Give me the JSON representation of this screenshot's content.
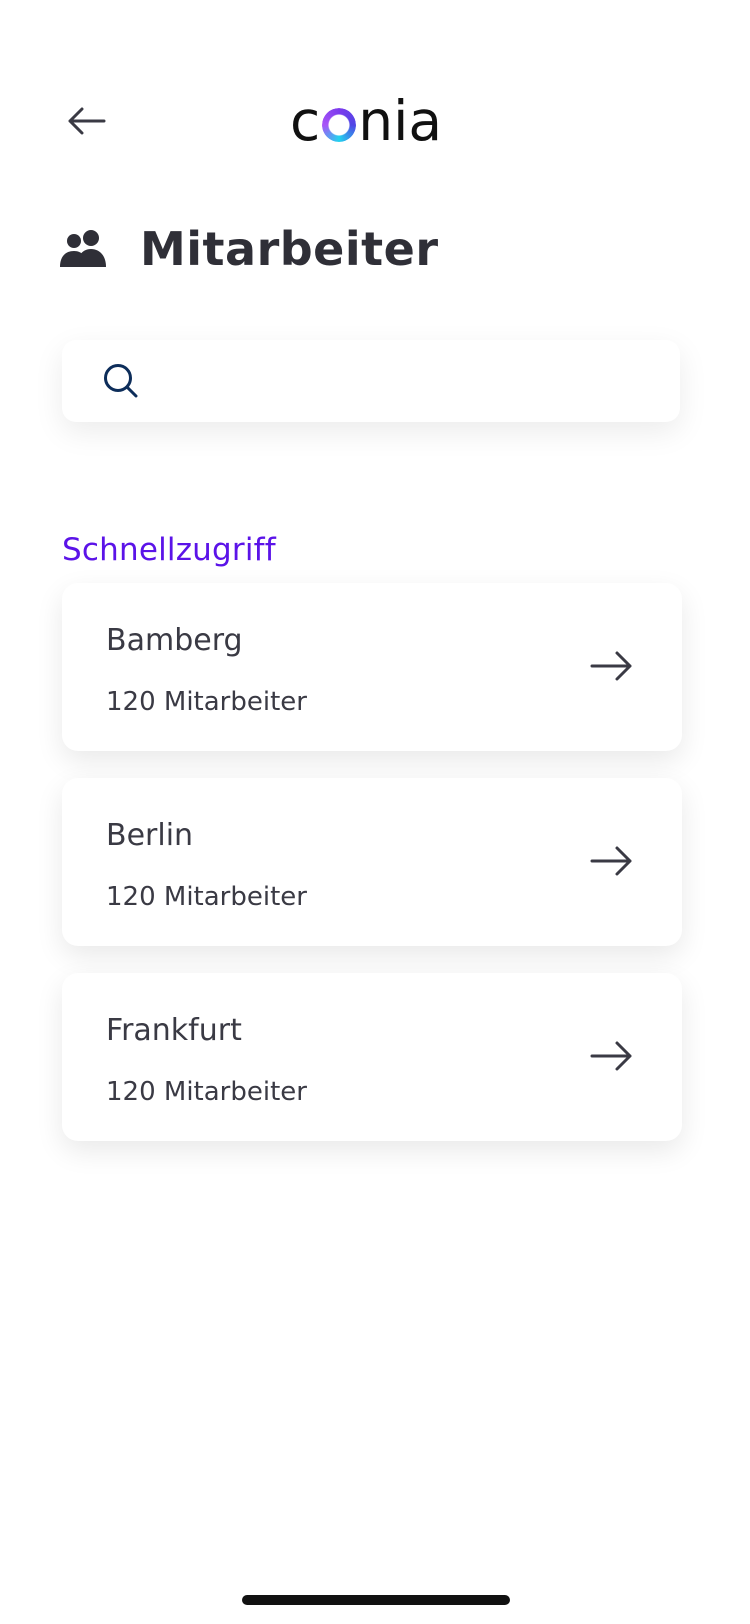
{
  "header": {
    "logo_before": "c",
    "logo_after": "nia"
  },
  "page": {
    "title": "Mitarbeiter"
  },
  "search": {
    "value": "",
    "placeholder": ""
  },
  "quick_access": {
    "label": "Schnellzugriff",
    "items": [
      {
        "title": "Bamberg",
        "subtitle": "120 Mitarbeiter"
      },
      {
        "title": "Berlin",
        "subtitle": "120 Mitarbeiter"
      },
      {
        "title": "Frankfurt",
        "subtitle": "120 Mitarbeiter"
      }
    ]
  },
  "icons": {
    "back": "arrow-left-icon",
    "people": "people-icon",
    "search": "search-icon",
    "card_arrow": "arrow-right-icon"
  },
  "colors": {
    "accent": "#5b13e8",
    "text": "#3a3a44",
    "search_icon": "#0d2d5a"
  }
}
